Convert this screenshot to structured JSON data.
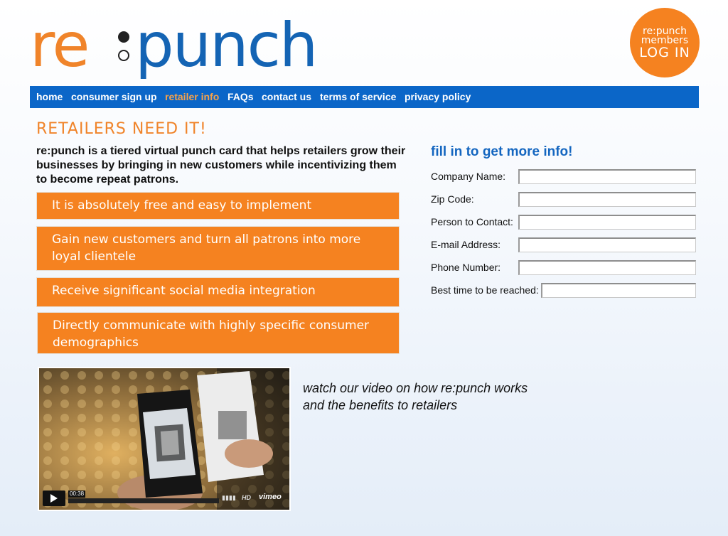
{
  "logo": {
    "re": "re",
    "punch": "punch"
  },
  "login_badge": {
    "line1": "re:punch",
    "line2": "members",
    "line3": "LOG IN"
  },
  "nav": {
    "items": [
      {
        "label": "home"
      },
      {
        "label": "consumer sign up"
      },
      {
        "label": "retailer info",
        "active": true
      },
      {
        "label": "FAQs"
      },
      {
        "label": "contact us"
      },
      {
        "label": "terms of service"
      },
      {
        "label": "privacy policy"
      }
    ]
  },
  "main": {
    "heading": "RETAILERS NEED IT!",
    "intro": "re:punch is a tiered virtual punch card that helps retailers grow their businesses by bringing in new customers while incentivizing them to become repeat patrons.",
    "benefits": [
      "It is absolutely free and easy to implement",
      "Gain new customers and turn all patrons into more loyal clientele",
      "Receive significant social media integration",
      "Directly communicate with highly specific consumer demographics"
    ]
  },
  "form": {
    "title": "fill in to get more info!",
    "fields": [
      {
        "label": "Company Name:",
        "value": ""
      },
      {
        "label": "Zip Code:",
        "value": ""
      },
      {
        "label": "Person to Contact:",
        "value": ""
      },
      {
        "label": "E-mail Address:",
        "value": ""
      },
      {
        "label": "Phone Number:",
        "value": ""
      },
      {
        "label": "Best time to be reached:",
        "value": ""
      }
    ]
  },
  "video": {
    "time": "00:38",
    "hd": "HD",
    "brand": "vimeo",
    "caption_line1": "watch our video on how re:punch works",
    "caption_line2": "and the benefits to retailers"
  },
  "colors": {
    "accent_orange": "#f58220",
    "brand_blue": "#0b66c8"
  }
}
